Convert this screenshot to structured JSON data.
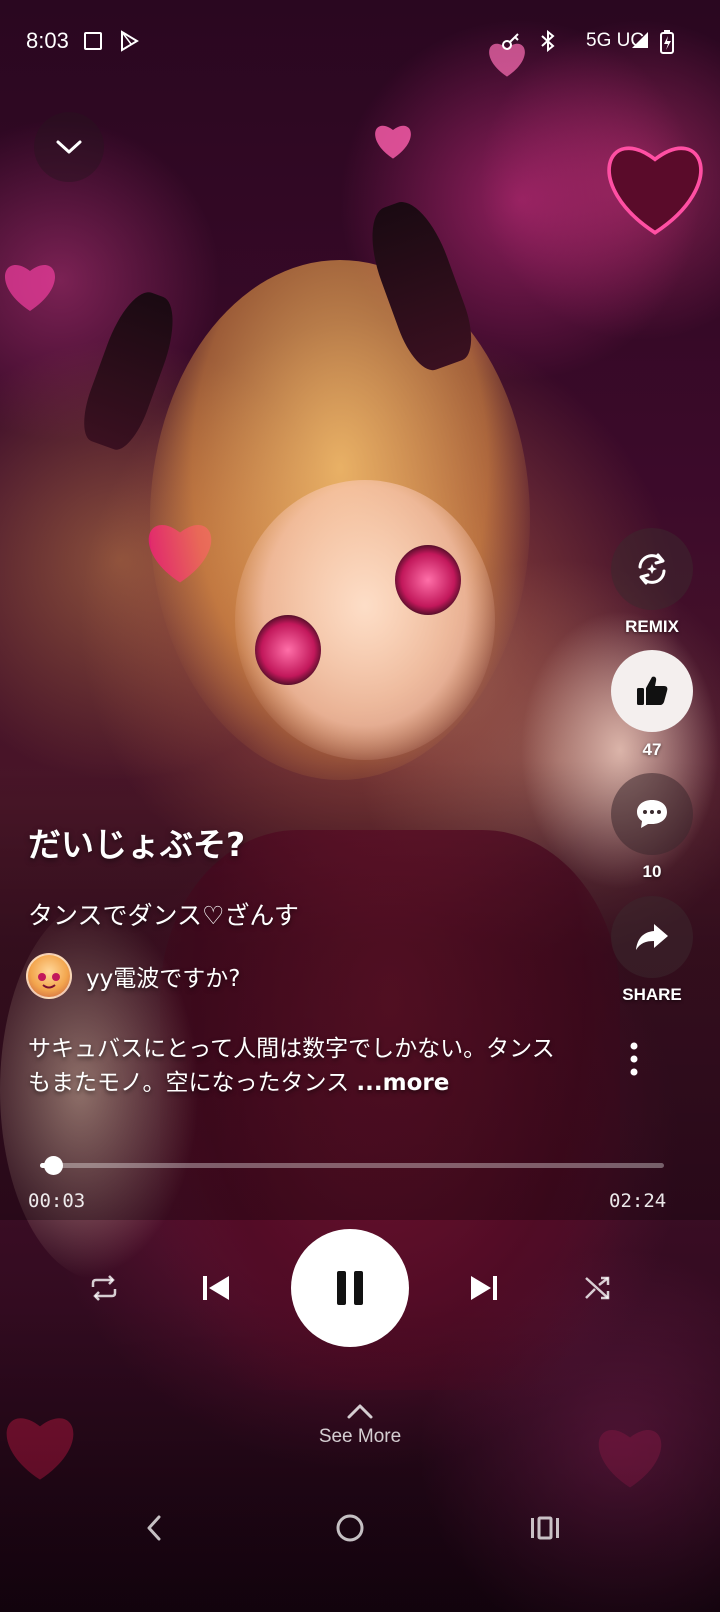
{
  "status_bar": {
    "time": "8:03",
    "network": "5G UC"
  },
  "player": {
    "title": "だいじょぶそ?",
    "subtitle": "タンスでダンス♡ざんす",
    "author": "yy電波ですか?",
    "description": "サキュバスにとって人間は数字でしかない。タンスもまたモノ。空になったタンス",
    "description_more": "...more",
    "progress": {
      "current": "00:03",
      "total": "02:24",
      "fraction": 0.021
    }
  },
  "actions": {
    "remix_label": "REMIX",
    "likes": "47",
    "comments": "10",
    "share_label": "SHARE"
  },
  "see_more_label": "See More",
  "icons": [
    "chevron-down-icon",
    "remix-icon",
    "thumbs-up-icon",
    "comment-icon",
    "share-icon",
    "more-vertical-icon",
    "repeat-icon",
    "skip-previous-icon",
    "pause-icon",
    "skip-next-icon",
    "shuffle-icon",
    "chevron-up-icon",
    "back-icon",
    "home-icon",
    "recents-icon"
  ],
  "colors": {
    "accent": "#ffffff",
    "button_dark": "#3c282d",
    "button_light": "#f4efee",
    "background": "#3c0a2a"
  }
}
